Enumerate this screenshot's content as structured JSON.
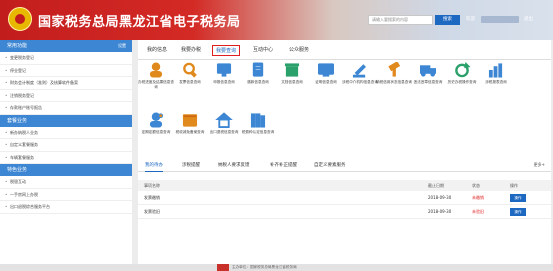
{
  "header": {
    "title": "国家税务总局黑龙江省电子税务局",
    "search_placeholder": "请输入要搜索的内容",
    "search_label": "搜索",
    "welcome": "欢迎",
    "logout": "退出"
  },
  "sidebar": {
    "sections": [
      {
        "title": "常用功能",
        "more": "设置",
        "items": [
          "变更税务登记",
          "停业登记",
          "财务会计制度（准则）及核算软件备案",
          "注销税务登记",
          "存款账户账号报告"
        ]
      },
      {
        "title": "套餐业务",
        "items": [
          "新办纳税人业务",
          "自定义套餐服务",
          "车辆套餐服务"
        ]
      },
      {
        "title": "特色业务",
        "items": [
          "税银互动",
          "一手房网上办税",
          "出口退税综合服务平台"
        ]
      }
    ]
  },
  "main": {
    "tabs": [
      "我的信息",
      "我要办税",
      "我要查询",
      "互动中心",
      "公众服务"
    ],
    "active_tab": 2,
    "functions": [
      {
        "label": "办税进度及结果信息查询",
        "icon": "person-icon",
        "color": "#e08a1e"
      },
      {
        "label": "发票信息查询",
        "icon": "search-icon",
        "color": "#e08a1e"
      },
      {
        "label": "申报信息查询",
        "icon": "monitor-icon",
        "color": "#3d86d3"
      },
      {
        "label": "缴款信息查询",
        "icon": "document-icon",
        "color": "#3d86d3"
      },
      {
        "label": "文档信息查询",
        "icon": "book-icon",
        "color": "#2aa06a"
      },
      {
        "label": "证明信息查询",
        "icon": "screen-icon",
        "color": "#3d86d3"
      },
      {
        "label": "涉税中介机构信息查询",
        "icon": "gavel-icon",
        "color": "#3d86d3"
      },
      {
        "label": "纳税信用状态信息查询",
        "icon": "hammer-icon",
        "color": "#e08a1e"
      },
      {
        "label": "违法违章信息查询",
        "icon": "truck-icon",
        "color": "#3d86d3"
      },
      {
        "label": "历史办税操作查询",
        "icon": "refresh-icon",
        "color": "#2aa06a"
      },
      {
        "label": "涉税报表查询",
        "icon": "bar-chart-icon",
        "color": "#3d86d3"
      },
      {
        "label": "定期定额信息查询",
        "icon": "person-star-icon",
        "color": "#3d86d3"
      },
      {
        "label": "税收减免备案查询",
        "icon": "calendar-icon",
        "color": "#e08a1e"
      },
      {
        "label": "出口退税信息查询",
        "icon": "house-icon",
        "color": "#3d86d3"
      },
      {
        "label": "税费种认定信息查询",
        "icon": "books-icon",
        "color": "#3d86d3"
      }
    ],
    "subtabs": [
      "我的待办",
      "涉税提醒",
      "纳税人要求反馈",
      "补齐补正提醒",
      "自定义要素服务"
    ],
    "more": "更多+",
    "table": {
      "headers": [
        "事项名称",
        "截止日期",
        "状态",
        "操作"
      ],
      "rows": [
        {
          "name": "发票缴销",
          "date": "2018-09-30",
          "status": "未缴销",
          "op": "操作"
        },
        {
          "name": "发票验旧",
          "date": "2018-09-30",
          "status": "未验旧",
          "op": "操作"
        }
      ]
    }
  },
  "footer": {
    "text": "主办单位：国家税务总局黑龙江省税务局"
  }
}
